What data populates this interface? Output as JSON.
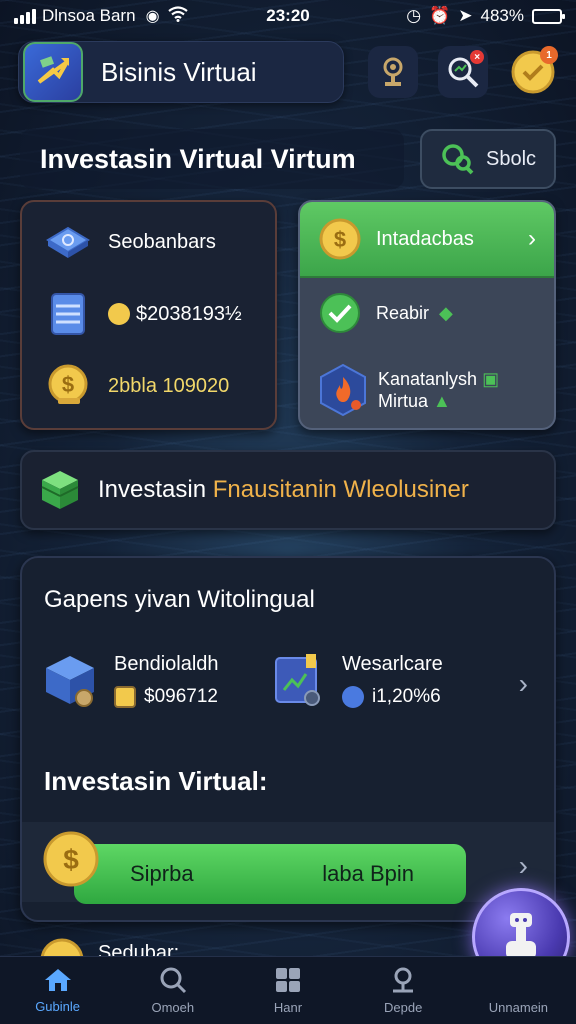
{
  "status_bar": {
    "carrier": "Dlnsoa Barn",
    "time": "23:20",
    "battery": "483%",
    "battery_level": 0.85
  },
  "header": {
    "app_title": "Bisinis Virtuai",
    "notification_badge": "1"
  },
  "section": {
    "title": "Investasin Virtual Virtum",
    "stats_label": "Sbolc"
  },
  "card_left": {
    "row1_label": "Seobanbars",
    "row2_value": "$2038193½",
    "row3_value": "2bbla 109020"
  },
  "card_right": {
    "header_label": "Intadacbas",
    "row1_label": "Reabir",
    "row2_line1": "Kanatanlysh",
    "row2_line2": "Mirtua"
  },
  "banner": {
    "text_white": "Investasin",
    "text_orange": "Fnausitanin",
    "text_white_2": "Wleolusiner"
  },
  "portfolio": {
    "title": "Gapens yivan Witolingual",
    "asset1_name": "Bendiolaldh",
    "asset1_amount": "$096712",
    "asset2_name": "Wesarlcare",
    "asset2_amount": "i1,20%6",
    "subtitle": "Investasin Virtual:",
    "cta_left": "Siprba",
    "cta_right": "laba Bpin"
  },
  "peek": {
    "label": "Sedubar:"
  },
  "bottom_nav": {
    "items": [
      {
        "label": "Gubinle"
      },
      {
        "label": "Omoeh"
      },
      {
        "label": "Hanr"
      },
      {
        "label": "Depde"
      },
      {
        "label": "Unnamein"
      }
    ]
  },
  "colors": {
    "accent_green": "#4cc157",
    "accent_gold": "#f2c94c",
    "nav_active": "#5aa8ff"
  }
}
